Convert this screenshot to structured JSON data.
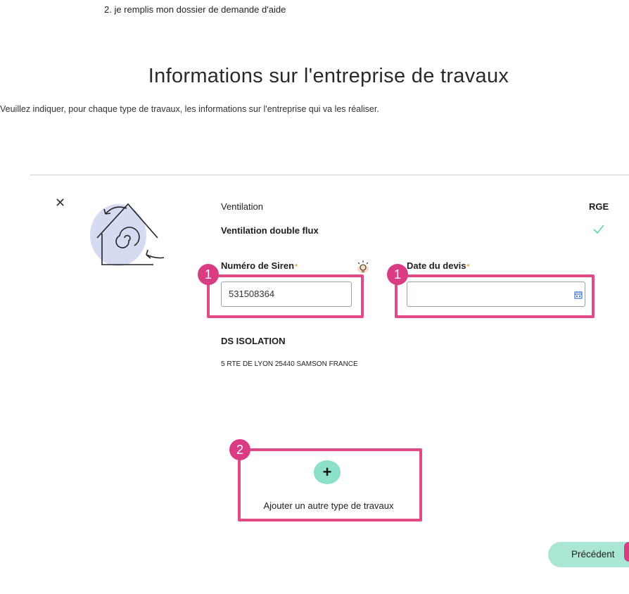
{
  "step": "2. je remplis mon dossier de demande d'aide",
  "title": "Informations sur l'entreprise de travaux",
  "intro": "Veuillez indiquer, pour chaque type de travaux, les informations sur l'entreprise qui va les réaliser.",
  "card": {
    "category": "Ventilation",
    "type": "Ventilation double flux",
    "rge_label": "RGE",
    "siren": {
      "label": "Numéro de Siren",
      "required_mark": "*",
      "value": "531508364"
    },
    "date": {
      "label": "Date du devis",
      "required_mark": "*",
      "value": ""
    },
    "company_name": "DS ISOLATION",
    "company_address": "5 RTE DE LYON 25440 SAMSON FRANCE"
  },
  "add_type_label": "Ajouter un autre type de travaux",
  "add_icon": "+",
  "prev_button": "Précédent",
  "annotations": {
    "marker_1": "1",
    "marker_2": "2"
  },
  "colors": {
    "highlight": "#e24a87",
    "accent_green": "#8de0c9",
    "prev_bg": "#a9e6d3"
  }
}
